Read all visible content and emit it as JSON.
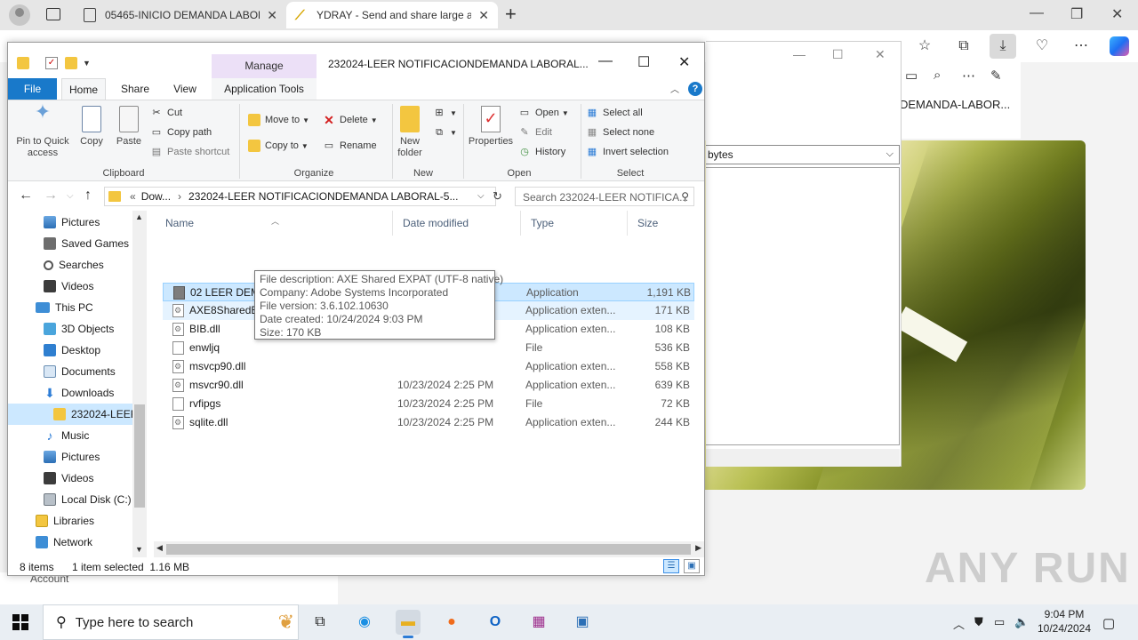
{
  "browser": {
    "tabs": [
      {
        "title": "05465-INICIO DEMANDA LABOR/",
        "favicon": "document-icon"
      },
      {
        "title": "YDRAY - Send and share large ar",
        "favicon": "ydray-icon",
        "active": true
      }
    ],
    "downloads_entry": "DEMANDA-LABOR..."
  },
  "background_dialog": {
    "select_value": "bytes"
  },
  "explorer": {
    "title": "232024-LEER NOTIFICACIONDEMANDA LABORAL...",
    "manage_label": "Manage",
    "ribbon_tabs": [
      "File",
      "Home",
      "Share",
      "View",
      "Application Tools"
    ],
    "ribbon": {
      "clipboard": {
        "label": "Clipboard",
        "pin": "Pin to Quick access",
        "copy": "Copy",
        "paste": "Paste",
        "cut": "Cut",
        "copy_path": "Copy path",
        "paste_shortcut": "Paste shortcut"
      },
      "organize": {
        "label": "Organize",
        "move_to": "Move to",
        "copy_to": "Copy to",
        "delete": "Delete",
        "rename": "Rename"
      },
      "new": {
        "label": "New",
        "new_folder": "New folder"
      },
      "open": {
        "label": "Open",
        "properties": "Properties",
        "open": "Open",
        "edit": "Edit",
        "history": "History"
      },
      "select": {
        "label": "Select",
        "select_all": "Select all",
        "select_none": "Select none",
        "invert": "Invert selection"
      }
    },
    "address": {
      "prefix": "Dow...",
      "current": "232024-LEER NOTIFICACIONDEMANDA LABORAL-5...",
      "search_placeholder": "Search 232024-LEER NOTIFICA..."
    },
    "nav": [
      {
        "label": "Pictures",
        "icon": "pictures-icon"
      },
      {
        "label": "Saved Games",
        "icon": "saved-games-icon"
      },
      {
        "label": "Searches",
        "icon": "searches-icon"
      },
      {
        "label": "Videos",
        "icon": "videos-icon"
      },
      {
        "label": "This PC",
        "icon": "this-pc-icon"
      },
      {
        "label": "3D Objects",
        "icon": "3d-objects-icon"
      },
      {
        "label": "Desktop",
        "icon": "desktop-icon"
      },
      {
        "label": "Documents",
        "icon": "documents-icon"
      },
      {
        "label": "Downloads",
        "icon": "downloads-icon"
      },
      {
        "label": "232024-LEER",
        "icon": "folder-icon",
        "selected": true
      },
      {
        "label": "Music",
        "icon": "music-icon"
      },
      {
        "label": "Pictures",
        "icon": "pictures-icon"
      },
      {
        "label": "Videos",
        "icon": "videos-icon"
      },
      {
        "label": "Local Disk (C:)",
        "icon": "local-disk-icon"
      },
      {
        "label": "Libraries",
        "icon": "libraries-icon"
      },
      {
        "label": "Network",
        "icon": "network-icon"
      }
    ],
    "columns": [
      "Name",
      "Date modified",
      "Type",
      "Size"
    ],
    "files": [
      {
        "name": "02 LEER DEMANDA LABORAL.exe",
        "date": "10/23/2024 2:25 PM",
        "type": "Application",
        "size": "1,191 KB",
        "icon": "exe"
      },
      {
        "name": "AXE8SharedExpat.dll",
        "date": "10/23/2024 2:25 PM",
        "type": "Application exten...",
        "size": "171 KB",
        "icon": "dll"
      },
      {
        "name": "BIB.dll",
        "date": "",
        "type": "Application exten...",
        "size": "108 KB",
        "icon": "dll"
      },
      {
        "name": "enwljq",
        "date": "",
        "type": "File",
        "size": "536 KB",
        "icon": "file"
      },
      {
        "name": "msvcp90.dll",
        "date": "",
        "type": "Application exten...",
        "size": "558 KB",
        "icon": "dll"
      },
      {
        "name": "msvcr90.dll",
        "date": "10/23/2024 2:25 PM",
        "type": "Application exten...",
        "size": "639 KB",
        "icon": "dll"
      },
      {
        "name": "rvfipgs",
        "date": "10/23/2024 2:25 PM",
        "type": "File",
        "size": "72 KB",
        "icon": "file"
      },
      {
        "name": "sqlite.dll",
        "date": "10/23/2024 2:25 PM",
        "type": "Application exten...",
        "size": "244 KB",
        "icon": "dll"
      }
    ],
    "tooltip": [
      "File description: AXE Shared EXPAT (UTF-8 native)",
      "Company: Adobe Systems Incorporated",
      "File version: 3.6.102.10630",
      "Date created: 10/24/2024 9:03 PM",
      "Size: 170 KB"
    ],
    "status": {
      "items": "8 items",
      "selection": "1 item selected  1.16 MB"
    }
  },
  "account_text": "Account",
  "watermark": "ANY RUN",
  "taskbar": {
    "search_placeholder": "Type here to search",
    "time": "9:04 PM",
    "date": "10/24/2024"
  }
}
